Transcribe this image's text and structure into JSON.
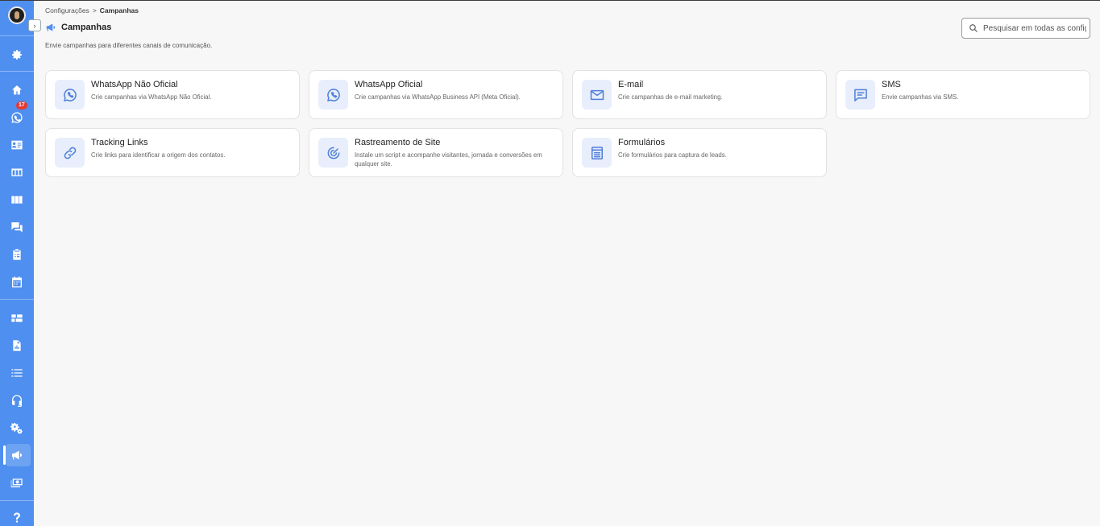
{
  "breadcrumb": {
    "parent": "Configurações",
    "separator": ">",
    "current": "Campanhas"
  },
  "page": {
    "title": "Campanhas",
    "subtitle": "Envie campanhas para diferentes canais de comunicação.",
    "icon": "megaphone-icon"
  },
  "search": {
    "placeholder": "Pesquisar em todas as configurações"
  },
  "sidebar": {
    "collapse_label": "›",
    "items": [
      {
        "name": "settings-gear",
        "icon": "gear-icon"
      },
      {
        "name": "home",
        "icon": "home-icon"
      },
      {
        "name": "whatsapp",
        "icon": "whatsapp-icon",
        "badge": "17"
      },
      {
        "name": "contacts",
        "icon": "contact-card-icon"
      },
      {
        "name": "pipeline",
        "icon": "columns-icon"
      },
      {
        "name": "kanban",
        "icon": "board-icon"
      },
      {
        "name": "chats",
        "icon": "chat-icon"
      },
      {
        "name": "tasks",
        "icon": "clipboard-icon"
      },
      {
        "name": "calendar",
        "icon": "calendar-icon"
      },
      {
        "name": "dashboard",
        "icon": "dashboard-icon"
      },
      {
        "name": "reports",
        "icon": "report-icon"
      },
      {
        "name": "lists",
        "icon": "list-icon"
      },
      {
        "name": "support",
        "icon": "headset-icon"
      },
      {
        "name": "automation",
        "icon": "gears-icon"
      },
      {
        "name": "campaigns",
        "icon": "megaphone-icon",
        "active": true
      },
      {
        "name": "finance",
        "icon": "money-icon"
      },
      {
        "name": "help",
        "icon": "help-icon"
      }
    ]
  },
  "cards": [
    {
      "title": "WhatsApp Não Oficial",
      "desc": "Crie campanhas via WhatsApp Não Oficial.",
      "icon": "whatsapp-icon"
    },
    {
      "title": "WhatsApp Oficial",
      "desc": "Crie campanhas via WhatsApp Business API (Meta Oficial).",
      "icon": "whatsapp-icon"
    },
    {
      "title": "E-mail",
      "desc": "Crie campanhas de e-mail marketing.",
      "icon": "mail-icon"
    },
    {
      "title": "SMS",
      "desc": "Envie campanhas via SMS.",
      "icon": "sms-icon"
    },
    {
      "title": "Tracking Links",
      "desc": "Crie links para identificar a origem dos contatos.",
      "icon": "link-icon"
    },
    {
      "title": "Rastreamento de Site",
      "desc": "Instale um script e acompanhe visitantes, jornada e conversões em qualquer site.",
      "icon": "radar-icon"
    },
    {
      "title": "Formulários",
      "desc": "Crie formulários para captura de leads.",
      "icon": "form-icon"
    }
  ],
  "colors": {
    "sidebar": "#4f8ff0",
    "accent": "#4f7fd9",
    "badge": "#e53935",
    "background": "#f7f7f7"
  }
}
